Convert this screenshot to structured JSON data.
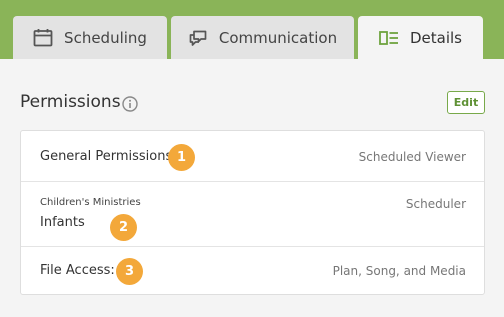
{
  "tabs": [
    {
      "label": "Scheduling",
      "icon": "calendar-icon",
      "active": false
    },
    {
      "label": "Communication",
      "icon": "chat-bubbles-icon",
      "active": false
    },
    {
      "label": "Details",
      "icon": "details-card-icon",
      "active": true
    }
  ],
  "permissions": {
    "title": "Permissions",
    "edit_label": "Edit",
    "rows": [
      {
        "label": "General Permissions",
        "value": "Scheduled Viewer",
        "badge": "1"
      },
      {
        "sublabel": "Children's Ministries",
        "label": "Infants",
        "value": "Scheduler",
        "badge": "2"
      },
      {
        "label": "File Access:",
        "value": "Plan, Song, and Media",
        "badge": "3"
      }
    ]
  },
  "colors": {
    "topbar": "#8ab458",
    "accent_green": "#5f9135",
    "badge": "#f3a83a"
  }
}
